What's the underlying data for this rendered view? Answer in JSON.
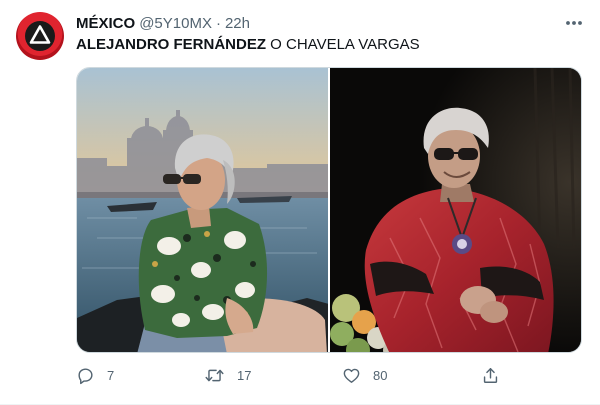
{
  "tweet": {
    "display_name": "MÉXICO",
    "handle": "@5Y10MX",
    "separator": "·",
    "time": "22h",
    "text_bold": "ALEJANDRO FERNÁNDEZ",
    "text_rest": " O CHAVELA VARGAS",
    "more_icon": "more-horizontal-icon",
    "avatar_icon": "triangle-mask-icon"
  },
  "media": {
    "images": [
      {
        "name": "photo-man-venice"
      },
      {
        "name": "photo-woman-stage"
      }
    ]
  },
  "actions": {
    "reply": {
      "icon": "reply-icon",
      "count": "7"
    },
    "retweet": {
      "icon": "retweet-icon",
      "count": "17"
    },
    "like": {
      "icon": "like-heart-icon",
      "count": "80"
    },
    "share": {
      "icon": "share-icon"
    }
  },
  "colors": {
    "text_primary": "#0f1419",
    "text_secondary": "#536471",
    "border": "#cfd9de",
    "avatar_red": "#e0242f"
  }
}
